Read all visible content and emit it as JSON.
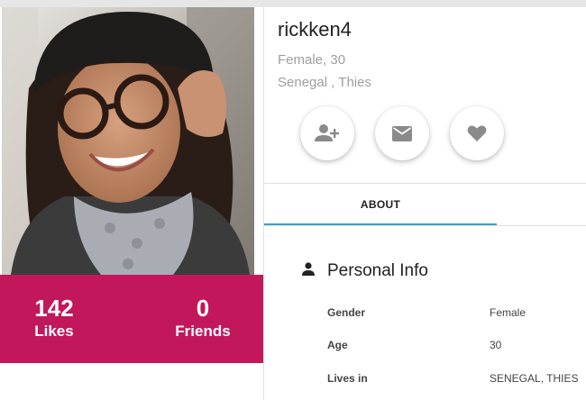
{
  "profile": {
    "username": "rickken4",
    "gender_age": "Female, 30",
    "location": "Senegal , Thies",
    "photo_alt": "profile-photo"
  },
  "stats": {
    "likes_count": "142",
    "likes_label": "Likes",
    "friends_count": "0",
    "friends_label": "Friends"
  },
  "actions": {
    "add_friend_icon": "person-add-icon",
    "message_icon": "mail-icon",
    "favorite_icon": "heart-icon"
  },
  "tabs": [
    {
      "label": "ABOUT",
      "active": true
    }
  ],
  "personal_info": {
    "title": "Personal Info",
    "icon": "person-icon",
    "rows": [
      {
        "label": "Gender",
        "value": "Female"
      },
      {
        "label": "Age",
        "value": "30"
      },
      {
        "label": "Lives in",
        "value": "SENEGAL, THIES"
      }
    ]
  },
  "colors": {
    "accent": "#c2185b",
    "tab_indicator": "#3aa1c4",
    "icon_gray": "#8a8a8a"
  }
}
